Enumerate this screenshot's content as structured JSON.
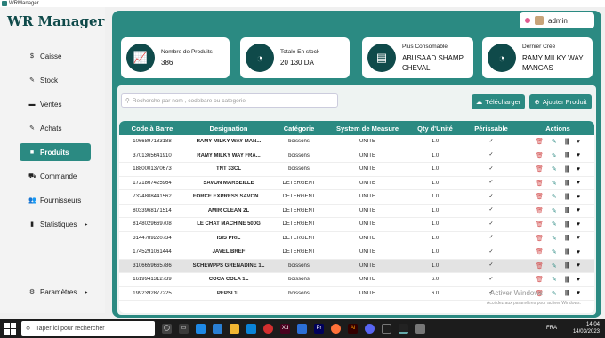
{
  "window": {
    "title": "WRManager"
  },
  "app": {
    "logo_wr": "WR",
    "logo_rest": "Manager"
  },
  "nav": [
    {
      "id": "caisse",
      "icon": "$",
      "label": "Caisse",
      "active": false
    },
    {
      "id": "stock",
      "icon": "✎",
      "label": "Stock",
      "active": false
    },
    {
      "id": "ventes",
      "icon": "▬",
      "label": "Ventes",
      "active": false
    },
    {
      "id": "achats",
      "icon": "✎",
      "label": "Achats",
      "active": false
    },
    {
      "id": "produits",
      "icon": "■",
      "label": "Produits",
      "active": true
    },
    {
      "id": "commande",
      "icon": "⛟",
      "label": "Commande",
      "active": false
    },
    {
      "id": "fournisseurs",
      "icon": "👥",
      "label": "Fournisseurs",
      "active": false
    },
    {
      "id": "statistiques",
      "icon": "▮",
      "label": "Statistiques",
      "active": false,
      "arrow": "▸"
    },
    {
      "id": "parametres",
      "icon": "⚙",
      "label": "Paramètres",
      "active": false,
      "arrow": "▸"
    }
  ],
  "user": {
    "name": "admin"
  },
  "cards": [
    {
      "title": "Nombre de Produits",
      "value": "386",
      "icon": "chart-up-icon"
    },
    {
      "title": "Totale En stock",
      "value": "20 130 DA",
      "icon": "pie-chart-icon"
    },
    {
      "title": "Plus Consomable",
      "value": "ABUSAAD SHAMP CHEVAL",
      "icon": "newspaper-icon"
    },
    {
      "title": "Dernier Crée",
      "value": "RAMY MILKY WAY MANGAS",
      "icon": "pie-chart-icon"
    }
  ],
  "search": {
    "placeholder": "Recherche par nom , codebare ou categorie"
  },
  "buttons": {
    "download": "Télécharger",
    "add": "Ajouter Produit"
  },
  "table": {
    "headers": [
      "Code à Barre",
      "Designation",
      "Catégorie",
      "System de Measure",
      "Qty d'Unité",
      "Périssable",
      "Actions"
    ],
    "rows": [
      {
        "code": "1066897183188",
        "name": "RAMY MILKY WAY MAN...",
        "cat": "boissons",
        "measure": "UNITE",
        "qty": "1.0",
        "per": "✓",
        "sel": false
      },
      {
        "code": "3701365641910",
        "name": "RAMY MILKY WAY FRA...",
        "cat": "boissons",
        "measure": "UNITE",
        "qty": "1.0",
        "per": "✓",
        "sel": false
      },
      {
        "code": "1880001370673",
        "name": "TNT 33CL",
        "cat": "boissons",
        "measure": "UNITE",
        "qty": "1.0",
        "per": "✓",
        "sel": false
      },
      {
        "code": "1721867425964",
        "name": "SAVON MARSEILLE",
        "cat": "DETERGENT",
        "measure": "UNITE",
        "qty": "1.0",
        "per": "✓",
        "sel": false
      },
      {
        "code": "7324808441562",
        "name": "FORCE EXPRESS SAVON ...",
        "cat": "DETERGENT",
        "measure": "UNITE",
        "qty": "1.0",
        "per": "✓",
        "sel": false
      },
      {
        "code": "8033968171514",
        "name": "AMIR CLEAN 2L",
        "cat": "DETERGENT",
        "measure": "UNITE",
        "qty": "1.0",
        "per": "✓",
        "sel": false
      },
      {
        "code": "8148029669708",
        "name": "LE CHAT MACHINE 500G",
        "cat": "DETERGENT",
        "measure": "UNITE",
        "qty": "1.0",
        "per": "✓",
        "sel": false
      },
      {
        "code": "3144789220734",
        "name": "ISIS PRIL",
        "cat": "DETERGENT",
        "measure": "UNITE",
        "qty": "1.0",
        "per": "✓",
        "sel": false
      },
      {
        "code": "1745291061444",
        "name": "JAVEL BREF",
        "cat": "DETERGENT",
        "measure": "UNITE",
        "qty": "1.0",
        "per": "✓",
        "sel": false
      },
      {
        "code": "3106659665786",
        "name": "SCHEWPPS GRENADINE 1L",
        "cat": "boissons",
        "measure": "UNITE",
        "qty": "1.0",
        "per": "✓",
        "sel": true
      },
      {
        "code": "1619941312739",
        "name": "COCA COLA 1L",
        "cat": "boissons",
        "measure": "UNITE",
        "qty": "6.0",
        "per": "✓",
        "sel": false
      },
      {
        "code": "1992392877225",
        "name": "PEPSI 1L",
        "cat": "boissons",
        "measure": "UNITE",
        "qty": "6.0",
        "per": "✓",
        "sel": false
      }
    ]
  },
  "watermark": {
    "line1": "Activer Windows",
    "line2": "Accédez aux paramètres pour activer Windows."
  },
  "taskbar": {
    "search": "Taper ici pour rechercher",
    "lang": "FRA",
    "time": "14:04",
    "date": "14/03/2023"
  }
}
